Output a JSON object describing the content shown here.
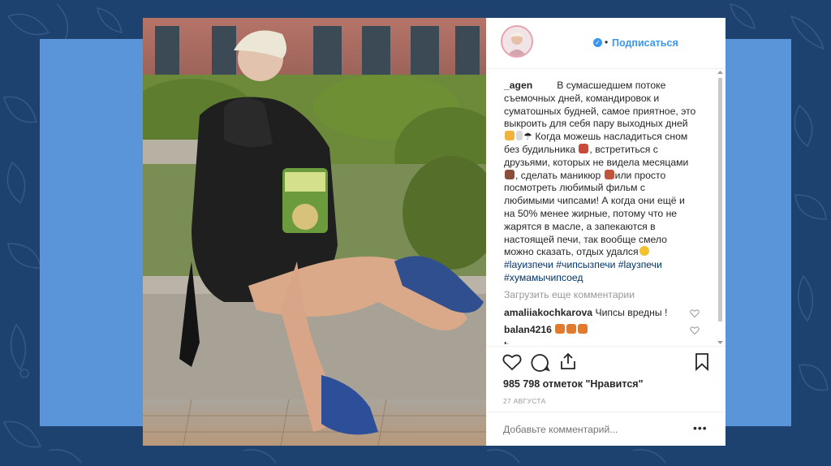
{
  "post": {
    "header": {
      "follow_label": "Подписаться",
      "verified_icon": "verified-badge-icon"
    },
    "caption": {
      "username": "_agen",
      "lines": [
        "В сумасшедшем потоке",
        "съемочных дней, командировок и",
        "суматошных будней, самое приятное, это",
        "выкроить для себя пару выходных дней",
        "Когда можешь насладиться сном",
        "без будильника",
        ", встретиться с",
        "друзьями, которых не видела месяцами",
        ", сделать маникюр",
        "или просто",
        "посмотреть любимый фильм с",
        "любимыми чипсами! А когда они ещё и",
        "на 50% менее жирные, потому что не",
        "жарятся в масле, а запекаются в",
        "настоящей печи, так вообще смело",
        "можно сказать, отдых удался"
      ],
      "hashtags_line1": "#layизпечи #чипсызпечи #layзпечи",
      "hashtags_line2": "#хумамычипсоед"
    },
    "load_more": "Загрузить еще комментарии",
    "comments": [
      {
        "user": "amaliiakochkarova",
        "text": "Чипсы вредны !"
      },
      {
        "user": "balan4216",
        "text": ""
      }
    ],
    "likes": "985 798 отметок \"Нравится\"",
    "date": "27 АВГУСТА",
    "add_comment_placeholder": "Добавьте комментарий...",
    "more_label": "•••"
  },
  "colors": {
    "background": "#1e4270",
    "panel": "#5b95d9",
    "link": "#3897f0",
    "hashtag": "#003569"
  }
}
